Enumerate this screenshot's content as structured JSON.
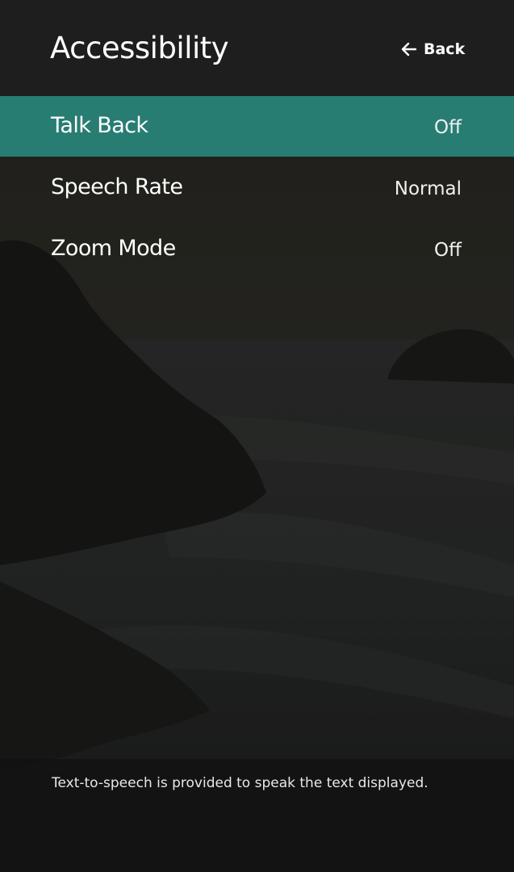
{
  "header": {
    "title": "Accessibility",
    "back_label": "Back",
    "back_icon": "arrow-left-icon"
  },
  "menu": {
    "items": [
      {
        "label": "Talk Back",
        "value": "Off",
        "selected": true
      },
      {
        "label": "Speech Rate",
        "value": "Normal",
        "selected": false
      },
      {
        "label": "Zoom Mode",
        "value": "Off",
        "selected": false
      }
    ]
  },
  "footer": {
    "note": "Text-to-speech is provided to speak the text displayed."
  },
  "colors": {
    "accent": "#287d73",
    "header_bg": "#1e1e20"
  }
}
